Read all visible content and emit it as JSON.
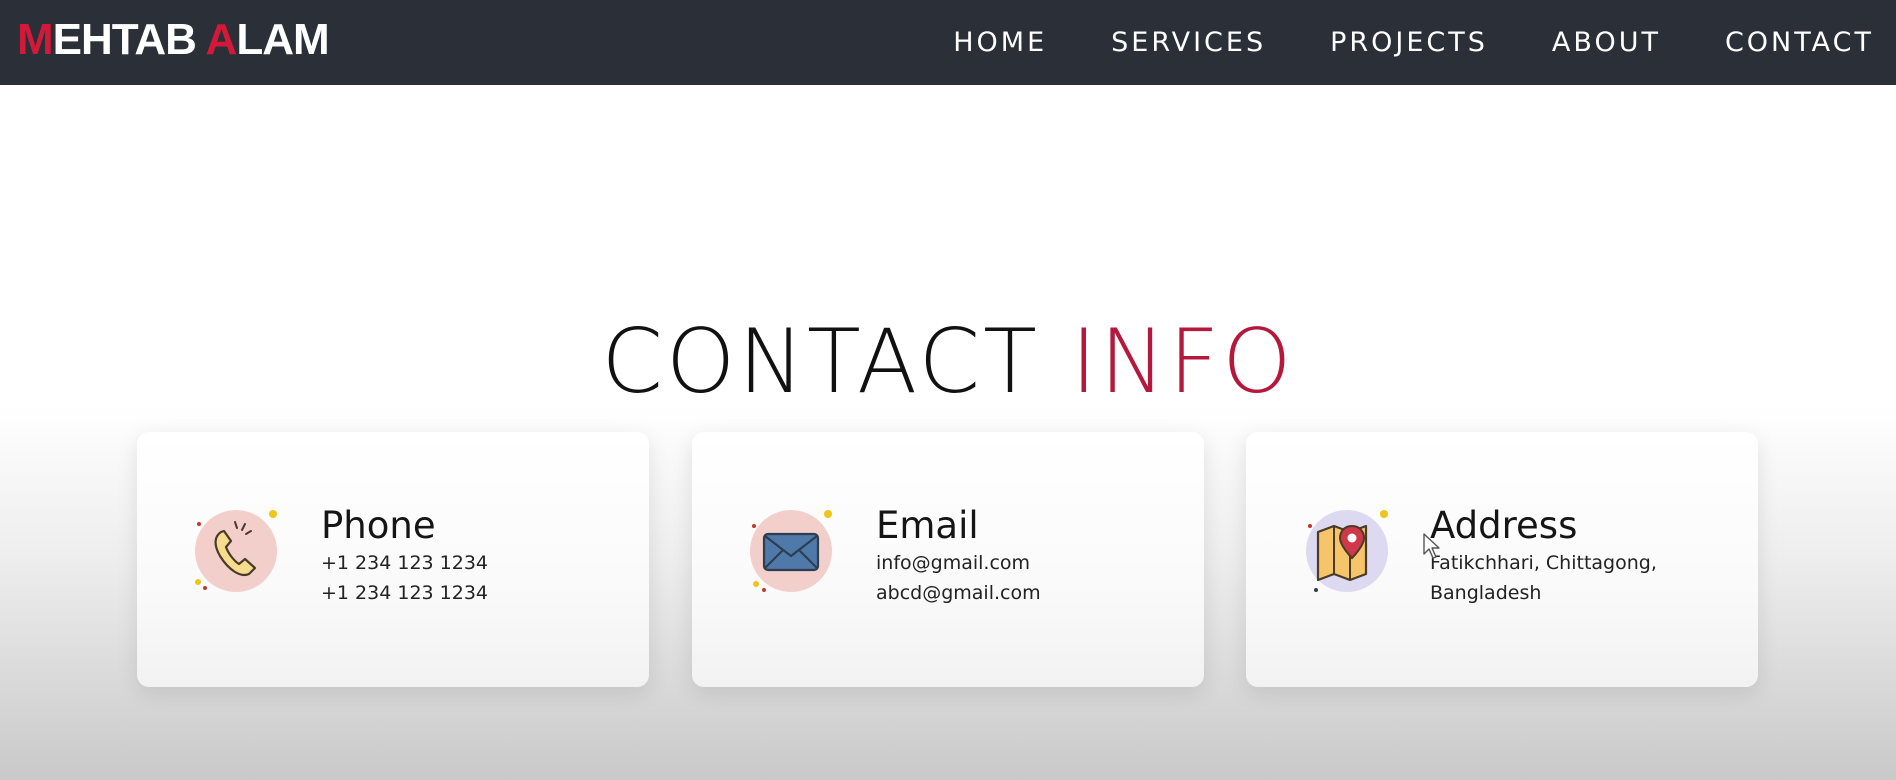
{
  "brand": {
    "first_initial": "M",
    "first_rest": "EHTAB",
    "last_initial": "A",
    "last_rest": "LAM",
    "accent_color": "#d3193a"
  },
  "nav": {
    "items": [
      {
        "label": "HOME"
      },
      {
        "label": "SERVICES"
      },
      {
        "label": "PROJECTS"
      },
      {
        "label": "ABOUT"
      },
      {
        "label": "CONTACT"
      }
    ],
    "background": "#2b2f37"
  },
  "contact_section": {
    "title_main": "CONTACT",
    "title_accent": "INFO",
    "accent_color": "#b5173d",
    "cards": [
      {
        "title": "Phone",
        "lines": [
          "+1 234 123 1234",
          "+1 234 123 1234"
        ],
        "icon": "phone-icon"
      },
      {
        "title": "Email",
        "lines": [
          "info@gmail.com",
          "abcd@gmail.com"
        ],
        "icon": "envelope-icon"
      },
      {
        "title": "Address",
        "lines": [
          "Fatikchhari, Chittagong,",
          "Bangladesh"
        ],
        "icon": "map-pin-icon"
      }
    ]
  }
}
